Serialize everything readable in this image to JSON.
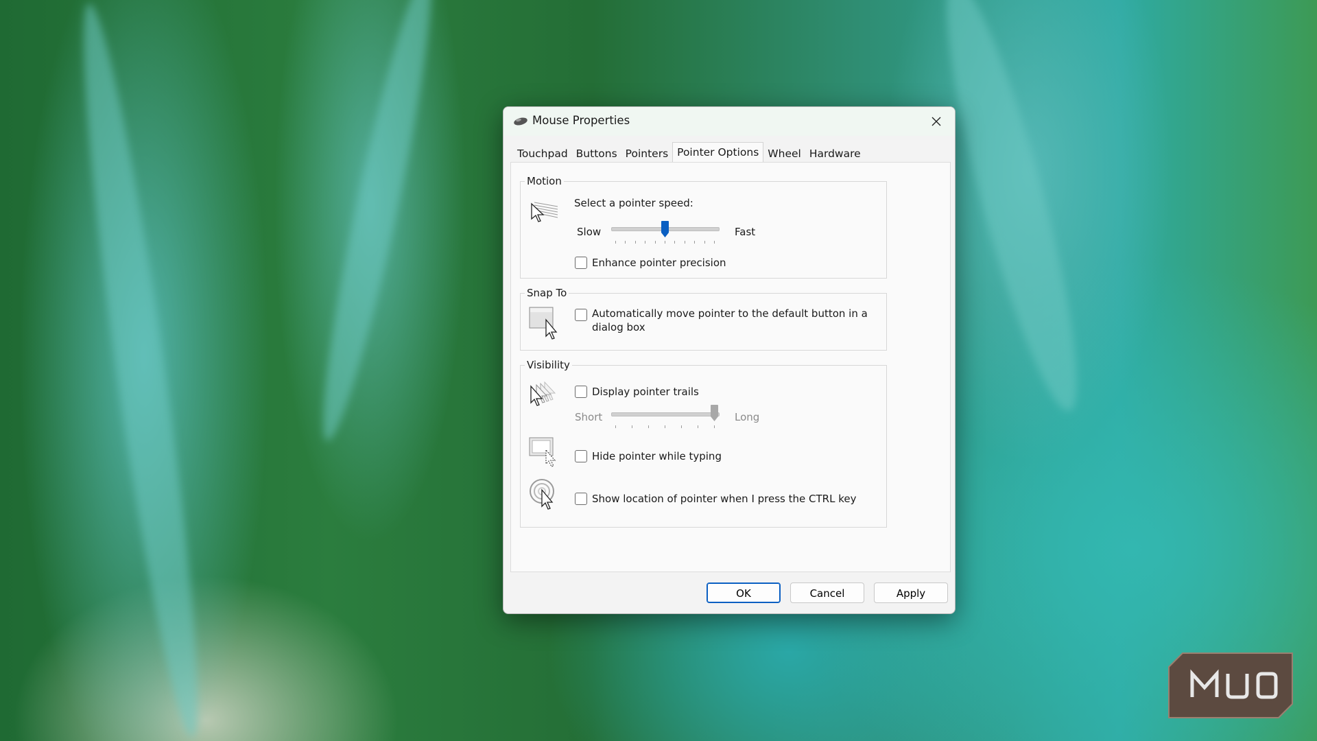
{
  "watermark": {
    "text": "MUO"
  },
  "window": {
    "title": "Mouse Properties",
    "icon": "mouse-icon"
  },
  "tabs": [
    {
      "label": "Touchpad",
      "active": false
    },
    {
      "label": "Buttons",
      "active": false
    },
    {
      "label": "Pointers",
      "active": false
    },
    {
      "label": "Pointer Options",
      "active": true
    },
    {
      "label": "Wheel",
      "active": false
    },
    {
      "label": "Hardware",
      "active": false
    }
  ],
  "motion": {
    "title": "Motion",
    "speed_label": "Select a pointer speed:",
    "slow_label": "Slow",
    "fast_label": "Fast",
    "speed_value": 0.5,
    "precision_label": "Enhance pointer precision",
    "precision_checked": true
  },
  "snap_to": {
    "title": "Snap To",
    "auto_move_label_line1": "Automatically move pointer to the default button in a",
    "auto_move_label_line2": "dialog box",
    "auto_move_checked": false
  },
  "visibility": {
    "title": "Visibility",
    "trails_label": "Display pointer trails",
    "trails_checked": false,
    "short_label": "Short",
    "long_label": "Long",
    "trails_value": 1.0,
    "hide_typing_label": "Hide pointer while typing",
    "hide_typing_checked": true,
    "show_location_label": "Show location of pointer when I press the CTRL key",
    "show_location_checked": true
  },
  "buttons": {
    "ok": "OK",
    "cancel": "Cancel",
    "apply": "Apply"
  },
  "colors": {
    "accent": "#0a5fc2",
    "titlebar": "#f0f7f2",
    "dialog_bg": "#f3f3f3"
  }
}
